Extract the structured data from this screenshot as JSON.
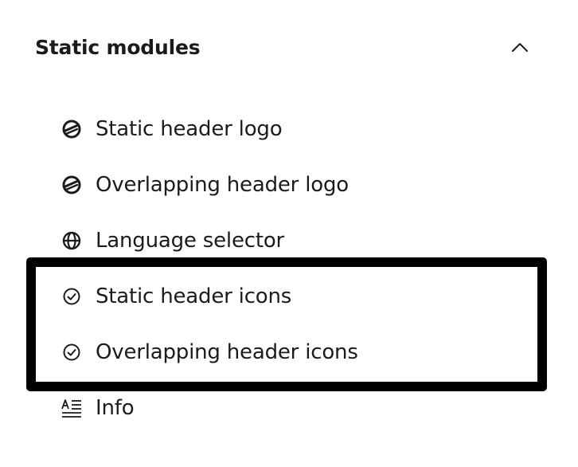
{
  "section": {
    "title": "Static modules",
    "toggle_icon": "chevron-up-icon"
  },
  "modules": [
    {
      "label": "Static header logo",
      "icon": "logo-icon"
    },
    {
      "label": "Overlapping header logo",
      "icon": "logo-icon"
    },
    {
      "label": "Language selector",
      "icon": "globe-icon"
    },
    {
      "label": "Static header icons",
      "icon": "check-circle-icon"
    },
    {
      "label": "Overlapping header icons",
      "icon": "check-circle-icon"
    },
    {
      "label": "Info",
      "icon": "text-format-icon"
    }
  ],
  "highlight": {
    "color": "#000000"
  }
}
